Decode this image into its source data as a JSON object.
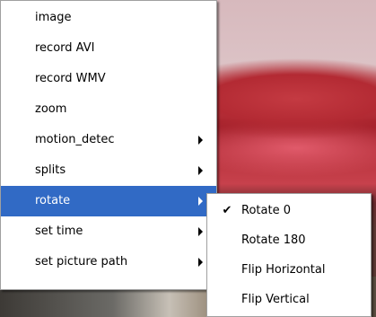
{
  "main_menu": {
    "items": [
      {
        "label": "image",
        "submenu": false
      },
      {
        "label": "record AVI",
        "submenu": false
      },
      {
        "label": "record WMV",
        "submenu": false
      },
      {
        "label": "zoom",
        "submenu": false
      },
      {
        "label": "motion_detec",
        "submenu": true
      },
      {
        "label": "splits",
        "submenu": true
      },
      {
        "label": "rotate",
        "submenu": true,
        "highlighted": true
      },
      {
        "label": "set time",
        "submenu": true
      },
      {
        "label": "set picture path",
        "submenu": true
      }
    ]
  },
  "rotate_submenu": {
    "items": [
      {
        "label": "Rotate 0",
        "checked": true,
        "check_glyph": "✔"
      },
      {
        "label": "Rotate 180",
        "checked": false
      },
      {
        "label": "Flip Horizontal",
        "checked": false
      },
      {
        "label": "Flip Vertical",
        "checked": false
      }
    ]
  },
  "colors": {
    "highlight": "#316ac5",
    "menu_background": "#ffffff"
  }
}
